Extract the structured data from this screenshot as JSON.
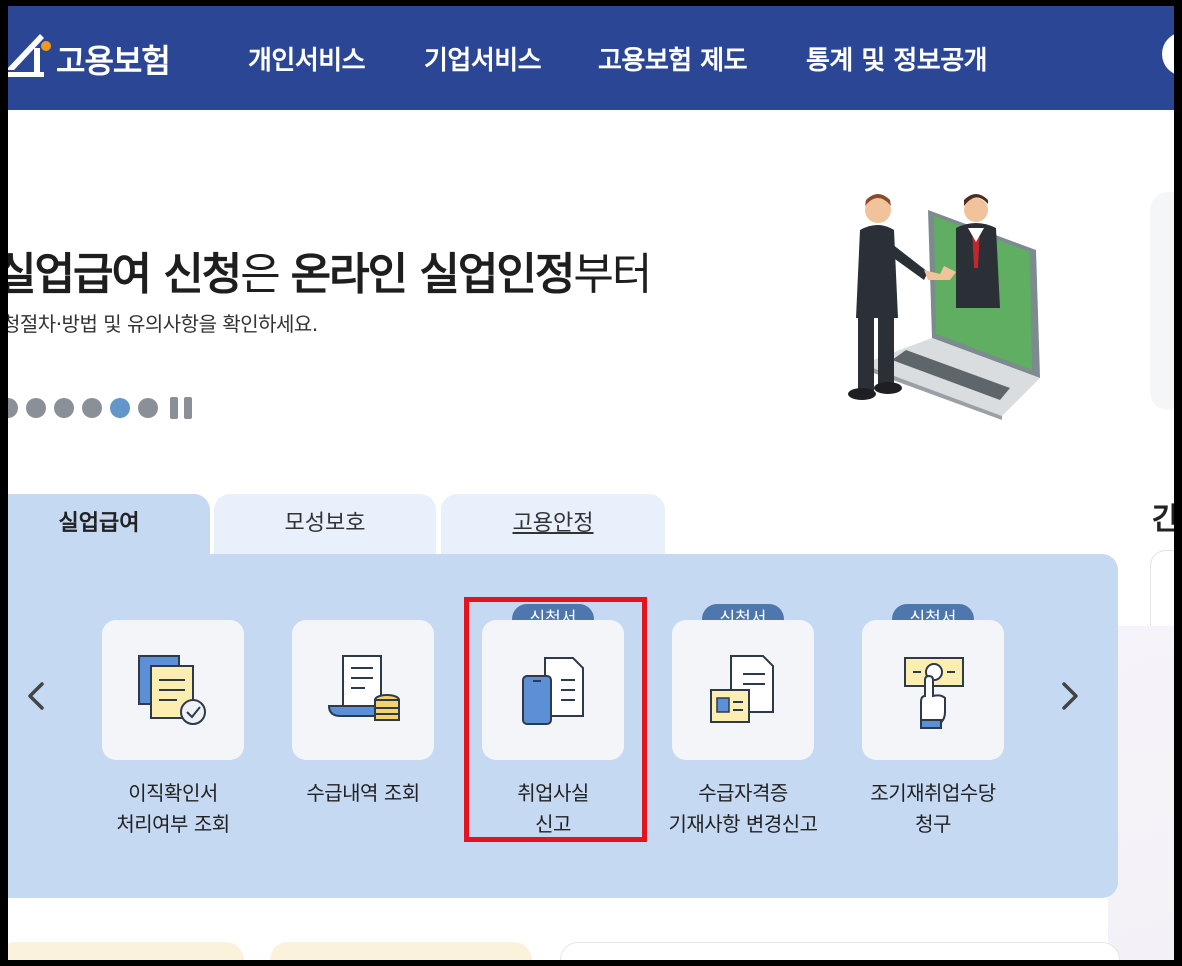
{
  "header": {
    "logo_text": "고용보험",
    "nav": [
      "개인서비스",
      "기업서비스",
      "고용보험 제도",
      "통계 및 정보공개"
    ]
  },
  "banner": {
    "title_parts": [
      {
        "text": "실업급여 신청",
        "bold": true
      },
      {
        "text": "은 ",
        "bold": false
      },
      {
        "text": "온라인 실업인정",
        "bold": true
      },
      {
        "text": "부터",
        "bold": false
      }
    ],
    "subtitle": "청절차·방법 및 유의사항을 확인하세요.",
    "slide_count": 6,
    "active_slide": 5
  },
  "side": {
    "heading": "간"
  },
  "tabs": [
    {
      "label": "실업급여",
      "active": true
    },
    {
      "label": "모성보호",
      "active": false
    },
    {
      "label": "고용안정",
      "active": false
    }
  ],
  "services": [
    {
      "label": "이직확인서\n처리여부 조회",
      "badge": "",
      "icon": "document-check-icon"
    },
    {
      "label": "수급내역 조회",
      "badge": "",
      "icon": "scroll-coins-icon"
    },
    {
      "label": "취업사실\n신고",
      "badge": "신청서",
      "icon": "phone-document-icon",
      "highlighted": true
    },
    {
      "label": "수급자격증\n기재사항 변경신고",
      "badge": "신청서",
      "icon": "id-card-document-icon"
    },
    {
      "label": "조기재취업수당\n청구",
      "badge": "신청서",
      "icon": "hand-cash-icon"
    }
  ],
  "colors": {
    "header_bg": "#2c4696",
    "panel_bg": "#c5d9f3",
    "badge_bg": "#4e78ad",
    "highlight": "#e3141e",
    "dot_active": "#6396c9"
  }
}
